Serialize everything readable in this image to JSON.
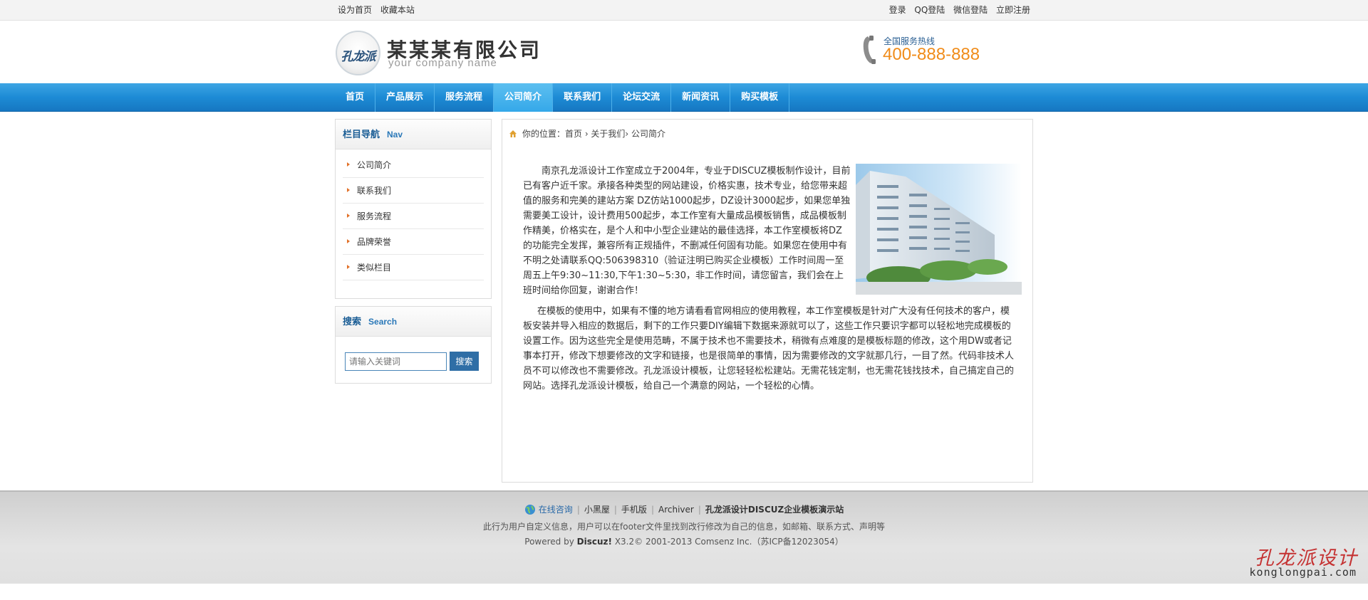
{
  "topbar": {
    "left_links": [
      "设为首页",
      "收藏本站"
    ],
    "right_links": [
      "登录",
      "QQ登陆",
      "微信登陆",
      "立即注册"
    ]
  },
  "header": {
    "logo_text": "孔龙派",
    "company_name": "某某某有限公司",
    "company_en": "your company name",
    "hotline_label": "全国服务热线",
    "hotline_number": "400-888-888"
  },
  "nav": {
    "items": [
      "首页",
      "产品展示",
      "服务流程",
      "公司简介",
      "联系我们",
      "论坛交流",
      "新闻资讯",
      "购买模板"
    ],
    "active_index": 3
  },
  "sidebar": {
    "nav_title": "栏目导航",
    "nav_title_en": "Nav",
    "nav_items": [
      "公司简介",
      "联系我们",
      "服务流程",
      "品牌荣誉",
      "类似栏目"
    ],
    "search_title": "搜索",
    "search_title_en": "Search",
    "search_placeholder": "请输入关键词",
    "search_button": "搜索"
  },
  "main": {
    "breadcrumb": "你的位置：首页 › 关于我们› 公司简介",
    "paragraph1": "南京孔龙派设计工作室成立于2004年，专业于DISCUZ模板制作设计，目前已有客户近千家。承接各种类型的网站建设，价格实惠，技术专业，给您带来超值的服务和完美的建站方案 DZ仿站1000起步，DZ设计3000起步，如果您单独需要美工设计，设计费用500起步，本工作室有大量成品模板销售，成品模板制作精美，价格实在，是个人和中小型企业建站的最佳选择，本工作室模板将DZ的功能完全发挥，兼容所有正规插件，不删减任何固有功能。如果您在使用中有不明之处请联系QQ:506398310（验证注明已购买企业模板）工作时间周一至周五上午9:30~11:30,下午1:30~5:30，非工作时间，请您留言，我们会在上班时间给你回复，谢谢合作！",
    "paragraph2": "在模板的使用中，如果有不懂的地方请看看官网相应的使用教程，本工作室模板是针对广大没有任何技术的客户，模板安装并导入相应的数据后，剩下的工作只要DIY编辑下数据来源就可以了，这些工作只要识字都可以轻松地完成模板的设置工作。因为这些完全是使用范畴，不属于技术也不需要技术，稍微有点难度的是模板标题的修改，这个用DW或者记事本打开，修改下想要修改的文字和链接，也是很简单的事情，因为需要修改的文字就那几行，一目了然。代码非技术人员不可以修改也不需要修改。孔龙派设计模板，让您轻轻松松建站。无需花钱定制，也无需花钱找技术，自己搞定自己的网站。选择孔龙派设计模板，给自己一个满意的网站，一个轻松的心情。"
  },
  "footer": {
    "online_consult": "在线咨询",
    "links": [
      "小黑屋",
      "手机版",
      "Archiver"
    ],
    "site_name": "孔龙派设计DISCUZ企业模板演示站",
    "info": "此行为用户自定义信息，用户可以在footer文件里找到改行修改为自己的信息，如邮箱、联系方式、声明等",
    "powered_prefix": "Powered by",
    "powered_brand": "Discuz!",
    "powered_rest": "X3.2© 2001-2013 Comsenz Inc.（苏ICP备12023054）"
  },
  "watermark": {
    "cn": "孔龙派设计",
    "en": "konglongpai.com"
  },
  "colors": {
    "nav_blue": "#1d8bd5",
    "hotline_orange": "#f08c1a",
    "title_blue": "#1a5d95",
    "watermark_red": "#c53232"
  }
}
